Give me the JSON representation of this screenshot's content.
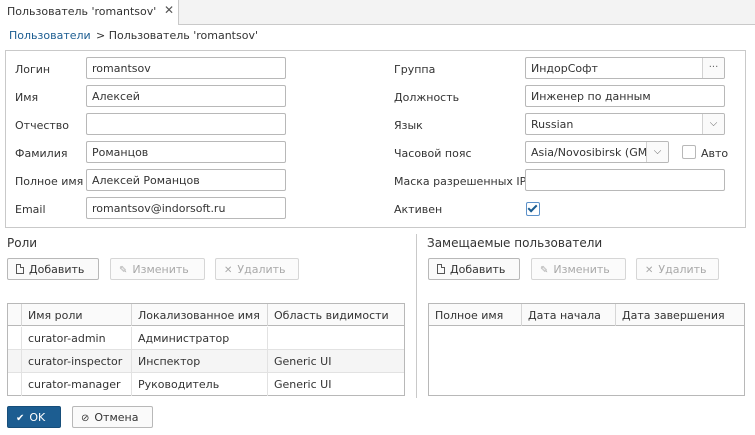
{
  "tab": {
    "title": "Пользователь 'romantsov'",
    "close": "✕"
  },
  "breadcrumb": {
    "link": "Пользователи",
    "separator_current": "> Пользователь 'romantsov'"
  },
  "form": {
    "login": {
      "label": "Логин",
      "value": "romantsov"
    },
    "name": {
      "label": "Имя",
      "value": "Алексей"
    },
    "middlename": {
      "label": "Отчество",
      "value": ""
    },
    "lastname": {
      "label": "Фамилия",
      "value": "Романцов"
    },
    "fullname": {
      "label": "Полное имя",
      "value": "Алексей Романцов"
    },
    "email": {
      "label": "Email",
      "value": "romantsov@indorsoft.ru"
    },
    "group": {
      "label": "Группа",
      "value": "ИндорСофт",
      "button": "···"
    },
    "position": {
      "label": "Должность",
      "value": "Инженер по данным"
    },
    "language": {
      "label": "Язык",
      "value": "Russian"
    },
    "timezone": {
      "label": "Часовой пояс",
      "value": "Asia/Novosibirsk (GMT",
      "auto_label": "Авто",
      "auto_checked": false
    },
    "ipmask": {
      "label": "Маска разрешенных IP",
      "value": ""
    },
    "active": {
      "label": "Активен",
      "checked": true
    }
  },
  "roles": {
    "title": "Роли",
    "buttons": {
      "add": "Добавить",
      "edit": "Изменить",
      "remove": "Удалить"
    },
    "columns": [
      "Имя роли",
      "Локализованное имя",
      "Область видимости"
    ],
    "rows": [
      [
        "curator-admin",
        "Администратор",
        ""
      ],
      [
        "curator-inspector",
        "Инспектор",
        "Generic UI"
      ],
      [
        "curator-manager",
        "Руководитель",
        "Generic UI"
      ]
    ]
  },
  "substituted": {
    "title": "Замещаемые пользователи",
    "buttons": {
      "add": "Добавить",
      "edit": "Изменить",
      "remove": "Удалить"
    },
    "columns": [
      "Полное имя",
      "Дата начала",
      "Дата завершения"
    ]
  },
  "footer": {
    "ok": "OK",
    "cancel": "Отмена"
  },
  "colors": {
    "accent": "#1c5d91",
    "border": "#b8b8b8"
  }
}
